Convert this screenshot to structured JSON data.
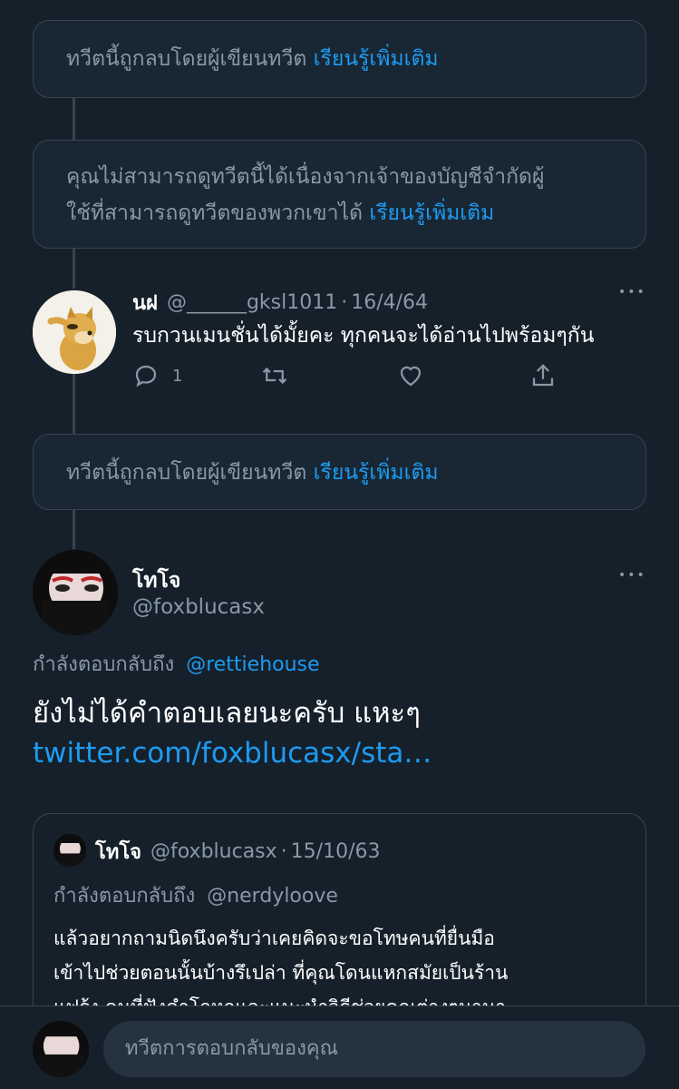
{
  "notices": [
    {
      "text": "ทวีตนี้ถูกลบโดยผู้เขียนทวีต",
      "link": "เรียนรู้เพิ่มเติม"
    },
    {
      "text_line1": "คุณไม่สามารถดูทวีตนี้ได้เนื่องจากเจ้าของบัญชีจำกัดผู้",
      "text_line2": "ใช้ที่สามารถดูทวีตของพวกเขาได้",
      "link": "เรียนรู้เพิ่มเติม"
    },
    {
      "text": "ทวีตนี้ถูกลบโดยผู้เขียนทวีต",
      "link": "เรียนรู้เพิ่มเติม"
    }
  ],
  "tweet1": {
    "name": "นฝ",
    "handle": "@______gksl1011",
    "separator": "·",
    "date": "16/4/64",
    "text": "รบกวนเมนชั่นได้มั้ยคะ ทุกคนจะได้อ่านไปพร้อมๆกัน",
    "reply_count": "1",
    "more": "•••"
  },
  "main_tweet": {
    "name": "โทโจ",
    "handle": "@foxblucasx",
    "replying_prefix": "กำลังตอบกลับถึง",
    "replying_to": "@rettiehouse",
    "text": "ยังไม่ได้คำตอบเลยนะครับ แหะๆ",
    "link": "twitter.com/foxblucasx/sta…",
    "more": "•••"
  },
  "quote": {
    "name": "โทโจ",
    "handle": "@foxblucasx",
    "separator": "·",
    "date": "15/10/63",
    "replying_prefix": "กำลังตอบกลับถึง",
    "replying_to": "@nerdyloove",
    "lines": [
      "แล้วอยากถามนิดนึงครับว่าเคยคิดจะขอโทษคนที่ยื่นมือ",
      "เข้าไปช่วยตอนนั้นบ้างรึเปล่า ที่คุณโดนแหกสมัยเป็นร้าน",
      "แฟร้ง คนที่ฟังคำโกหกและแนะนำวิธีช่วยคณต่างๆนานา"
    ]
  },
  "reply_bar": {
    "placeholder": "ทวีตการตอบกลับของคุณ"
  },
  "colors": {
    "background": "#15202b",
    "link": "#1d9bf0",
    "muted": "#8899a6",
    "border": "#38444d"
  }
}
